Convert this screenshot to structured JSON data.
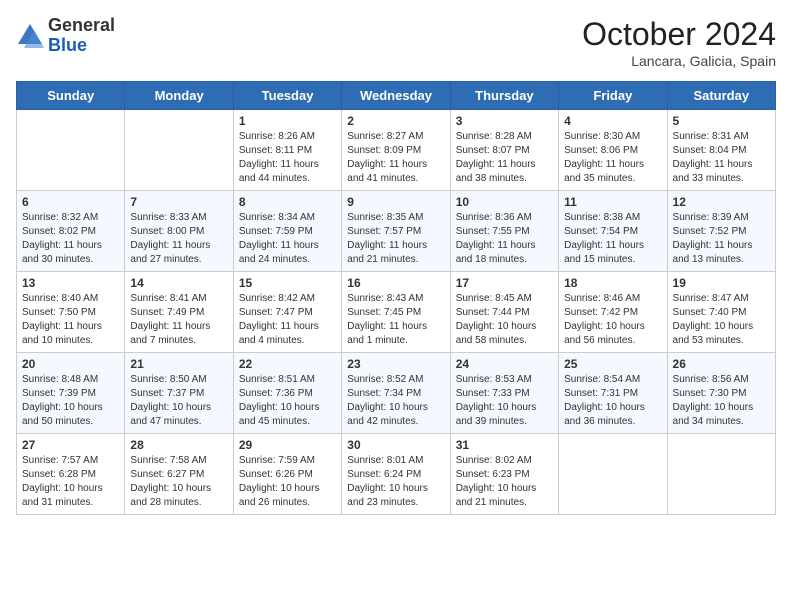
{
  "header": {
    "logo_general": "General",
    "logo_blue": "Blue",
    "month_title": "October 2024",
    "location": "Lancara, Galicia, Spain"
  },
  "days_of_week": [
    "Sunday",
    "Monday",
    "Tuesday",
    "Wednesday",
    "Thursday",
    "Friday",
    "Saturday"
  ],
  "weeks": [
    [
      {
        "day": "",
        "content": ""
      },
      {
        "day": "",
        "content": ""
      },
      {
        "day": "1",
        "content": "Sunrise: 8:26 AM\nSunset: 8:11 PM\nDaylight: 11 hours and 44 minutes."
      },
      {
        "day": "2",
        "content": "Sunrise: 8:27 AM\nSunset: 8:09 PM\nDaylight: 11 hours and 41 minutes."
      },
      {
        "day": "3",
        "content": "Sunrise: 8:28 AM\nSunset: 8:07 PM\nDaylight: 11 hours and 38 minutes."
      },
      {
        "day": "4",
        "content": "Sunrise: 8:30 AM\nSunset: 8:06 PM\nDaylight: 11 hours and 35 minutes."
      },
      {
        "day": "5",
        "content": "Sunrise: 8:31 AM\nSunset: 8:04 PM\nDaylight: 11 hours and 33 minutes."
      }
    ],
    [
      {
        "day": "6",
        "content": "Sunrise: 8:32 AM\nSunset: 8:02 PM\nDaylight: 11 hours and 30 minutes."
      },
      {
        "day": "7",
        "content": "Sunrise: 8:33 AM\nSunset: 8:00 PM\nDaylight: 11 hours and 27 minutes."
      },
      {
        "day": "8",
        "content": "Sunrise: 8:34 AM\nSunset: 7:59 PM\nDaylight: 11 hours and 24 minutes."
      },
      {
        "day": "9",
        "content": "Sunrise: 8:35 AM\nSunset: 7:57 PM\nDaylight: 11 hours and 21 minutes."
      },
      {
        "day": "10",
        "content": "Sunrise: 8:36 AM\nSunset: 7:55 PM\nDaylight: 11 hours and 18 minutes."
      },
      {
        "day": "11",
        "content": "Sunrise: 8:38 AM\nSunset: 7:54 PM\nDaylight: 11 hours and 15 minutes."
      },
      {
        "day": "12",
        "content": "Sunrise: 8:39 AM\nSunset: 7:52 PM\nDaylight: 11 hours and 13 minutes."
      }
    ],
    [
      {
        "day": "13",
        "content": "Sunrise: 8:40 AM\nSunset: 7:50 PM\nDaylight: 11 hours and 10 minutes."
      },
      {
        "day": "14",
        "content": "Sunrise: 8:41 AM\nSunset: 7:49 PM\nDaylight: 11 hours and 7 minutes."
      },
      {
        "day": "15",
        "content": "Sunrise: 8:42 AM\nSunset: 7:47 PM\nDaylight: 11 hours and 4 minutes."
      },
      {
        "day": "16",
        "content": "Sunrise: 8:43 AM\nSunset: 7:45 PM\nDaylight: 11 hours and 1 minute."
      },
      {
        "day": "17",
        "content": "Sunrise: 8:45 AM\nSunset: 7:44 PM\nDaylight: 10 hours and 58 minutes."
      },
      {
        "day": "18",
        "content": "Sunrise: 8:46 AM\nSunset: 7:42 PM\nDaylight: 10 hours and 56 minutes."
      },
      {
        "day": "19",
        "content": "Sunrise: 8:47 AM\nSunset: 7:40 PM\nDaylight: 10 hours and 53 minutes."
      }
    ],
    [
      {
        "day": "20",
        "content": "Sunrise: 8:48 AM\nSunset: 7:39 PM\nDaylight: 10 hours and 50 minutes."
      },
      {
        "day": "21",
        "content": "Sunrise: 8:50 AM\nSunset: 7:37 PM\nDaylight: 10 hours and 47 minutes."
      },
      {
        "day": "22",
        "content": "Sunrise: 8:51 AM\nSunset: 7:36 PM\nDaylight: 10 hours and 45 minutes."
      },
      {
        "day": "23",
        "content": "Sunrise: 8:52 AM\nSunset: 7:34 PM\nDaylight: 10 hours and 42 minutes."
      },
      {
        "day": "24",
        "content": "Sunrise: 8:53 AM\nSunset: 7:33 PM\nDaylight: 10 hours and 39 minutes."
      },
      {
        "day": "25",
        "content": "Sunrise: 8:54 AM\nSunset: 7:31 PM\nDaylight: 10 hours and 36 minutes."
      },
      {
        "day": "26",
        "content": "Sunrise: 8:56 AM\nSunset: 7:30 PM\nDaylight: 10 hours and 34 minutes."
      }
    ],
    [
      {
        "day": "27",
        "content": "Sunrise: 7:57 AM\nSunset: 6:28 PM\nDaylight: 10 hours and 31 minutes."
      },
      {
        "day": "28",
        "content": "Sunrise: 7:58 AM\nSunset: 6:27 PM\nDaylight: 10 hours and 28 minutes."
      },
      {
        "day": "29",
        "content": "Sunrise: 7:59 AM\nSunset: 6:26 PM\nDaylight: 10 hours and 26 minutes."
      },
      {
        "day": "30",
        "content": "Sunrise: 8:01 AM\nSunset: 6:24 PM\nDaylight: 10 hours and 23 minutes."
      },
      {
        "day": "31",
        "content": "Sunrise: 8:02 AM\nSunset: 6:23 PM\nDaylight: 10 hours and 21 minutes."
      },
      {
        "day": "",
        "content": ""
      },
      {
        "day": "",
        "content": ""
      }
    ]
  ]
}
